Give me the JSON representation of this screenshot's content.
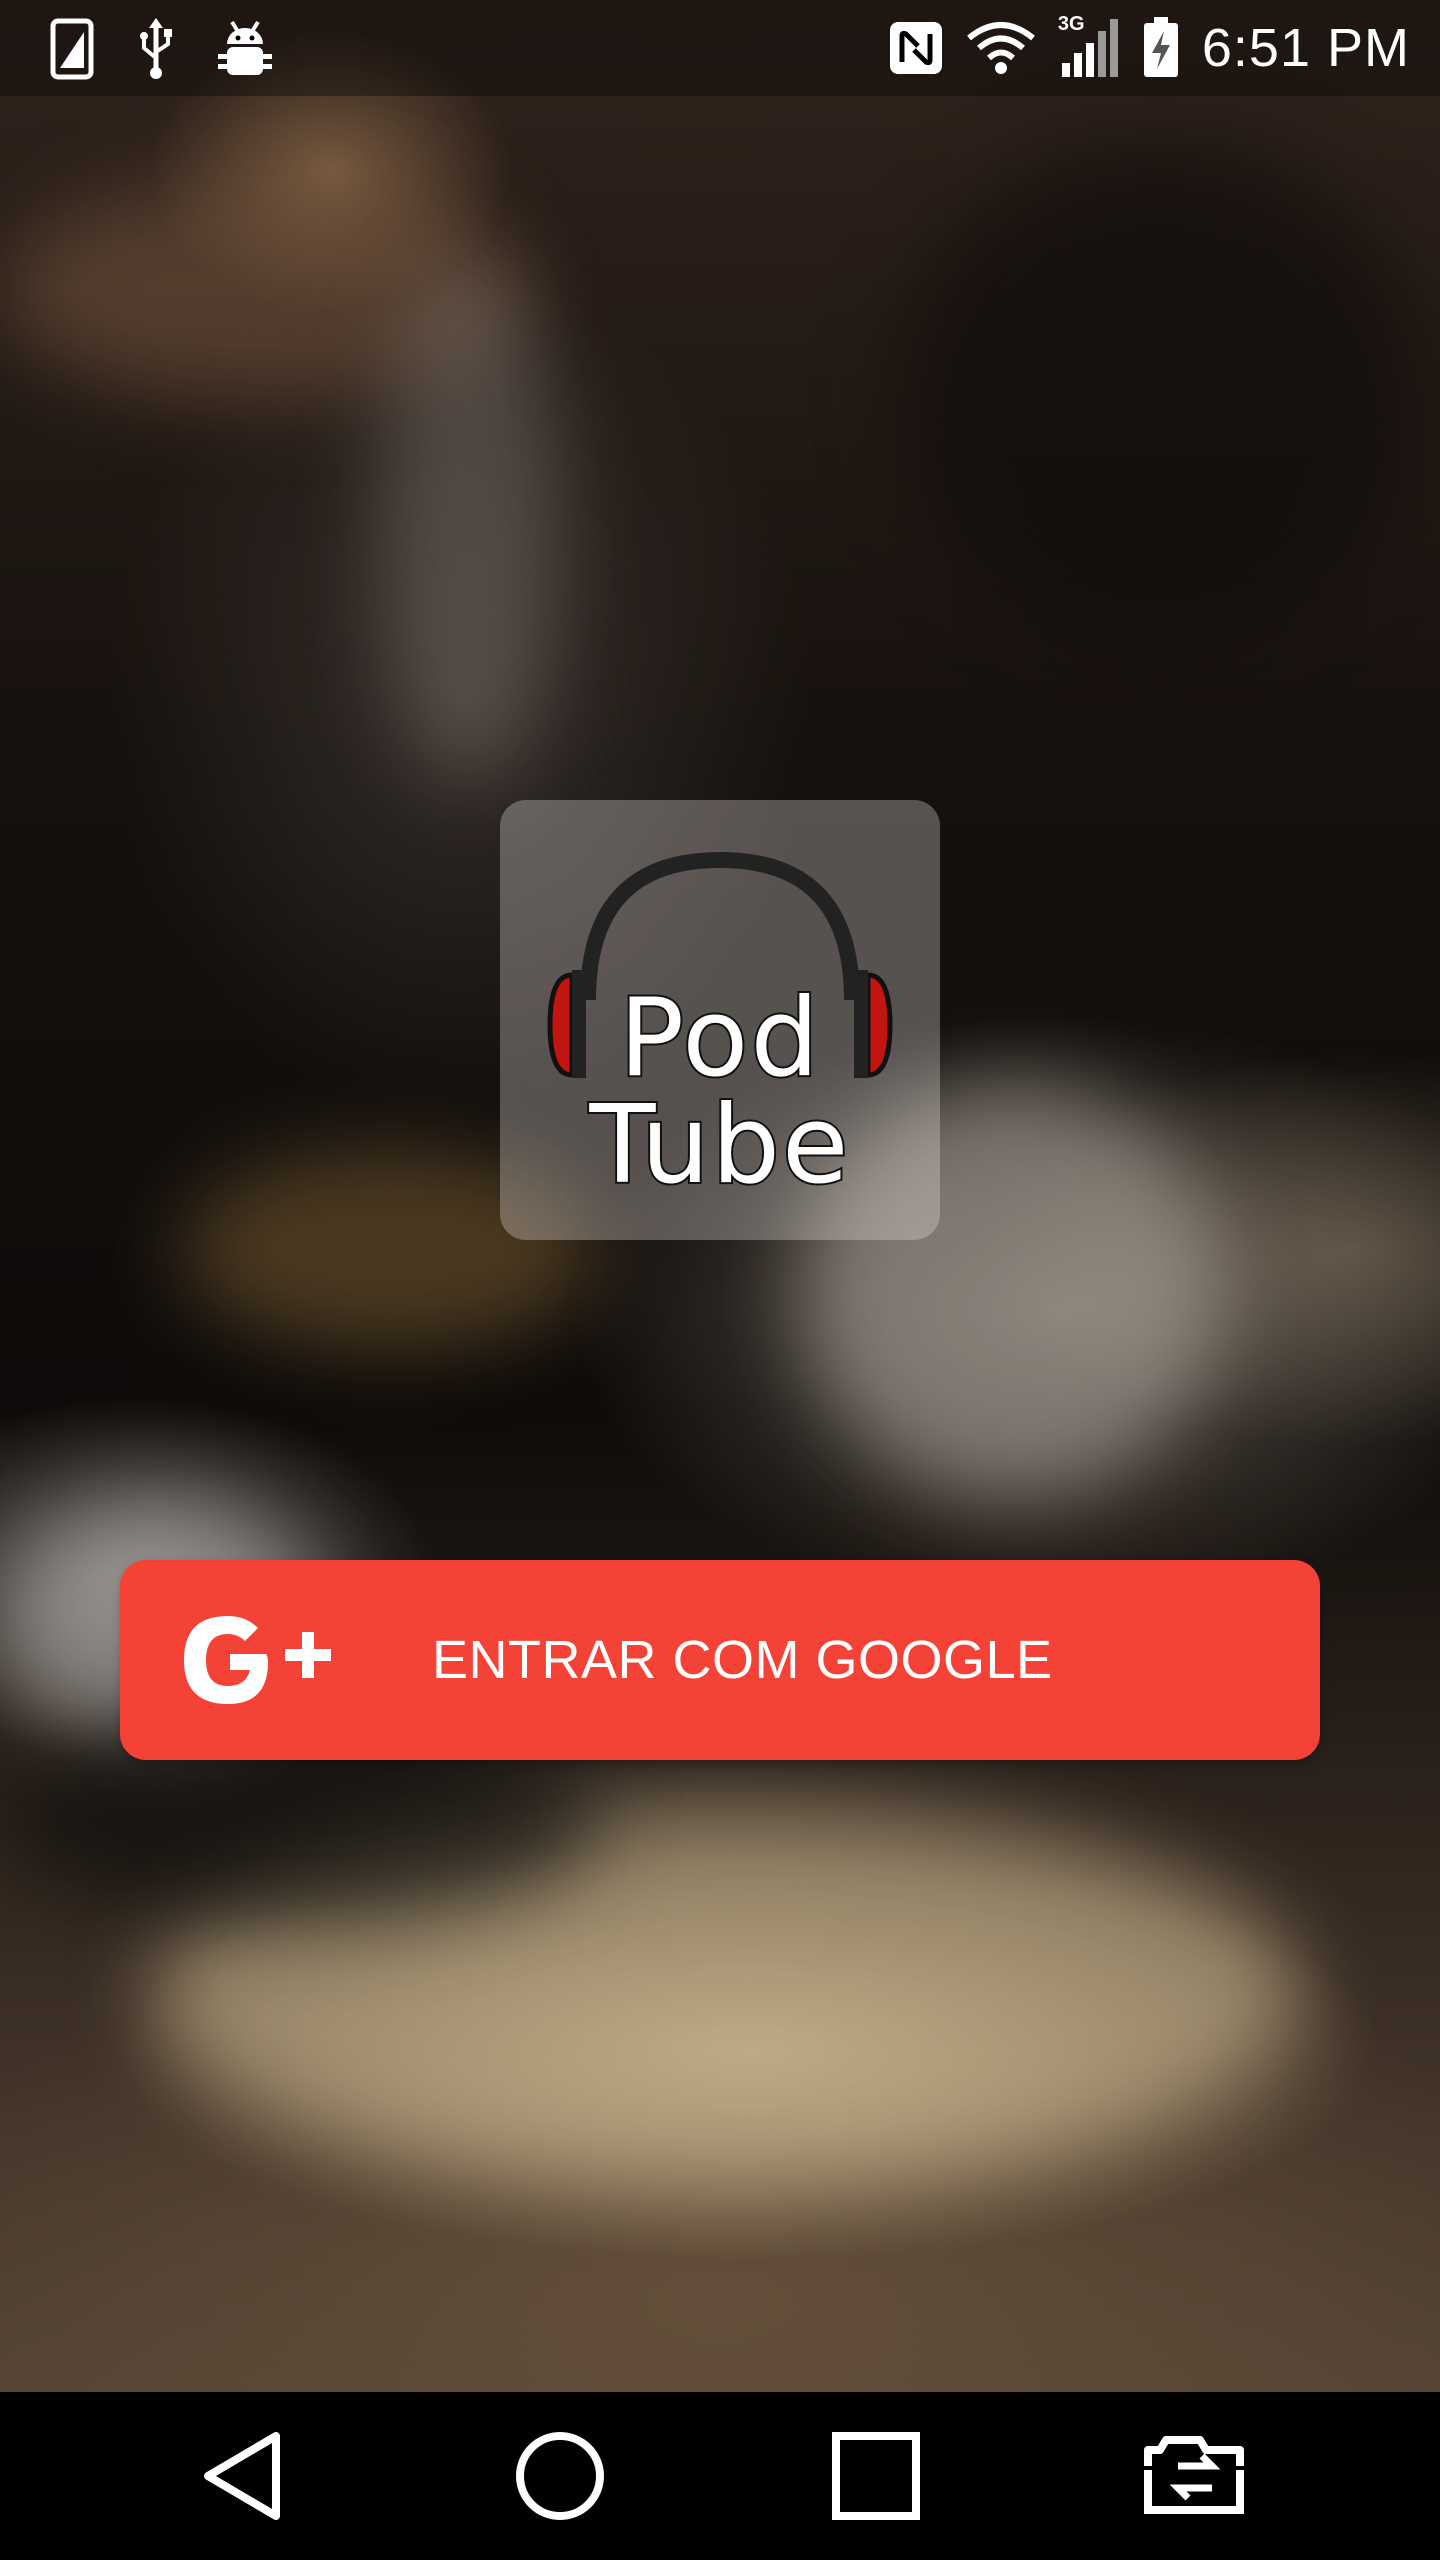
{
  "status_bar": {
    "time": "6:51 PM",
    "network_label": "3G",
    "left_icons": [
      "screenshot-icon",
      "usb-icon",
      "android-debug-icon"
    ],
    "right_icons": [
      "nfc-icon",
      "wifi-icon",
      "signal-icon",
      "battery-charging-icon"
    ]
  },
  "logo": {
    "line1": "Pod",
    "line2": "Tube",
    "icon": "headphones-icon"
  },
  "login": {
    "google_label": "ENTRAR COM GOOGLE",
    "icon": "google-plus-icon",
    "color": "#f44336"
  },
  "nav_bar": {
    "buttons": [
      "back-icon",
      "home-icon",
      "recents-icon",
      "dual-window-icon"
    ]
  }
}
